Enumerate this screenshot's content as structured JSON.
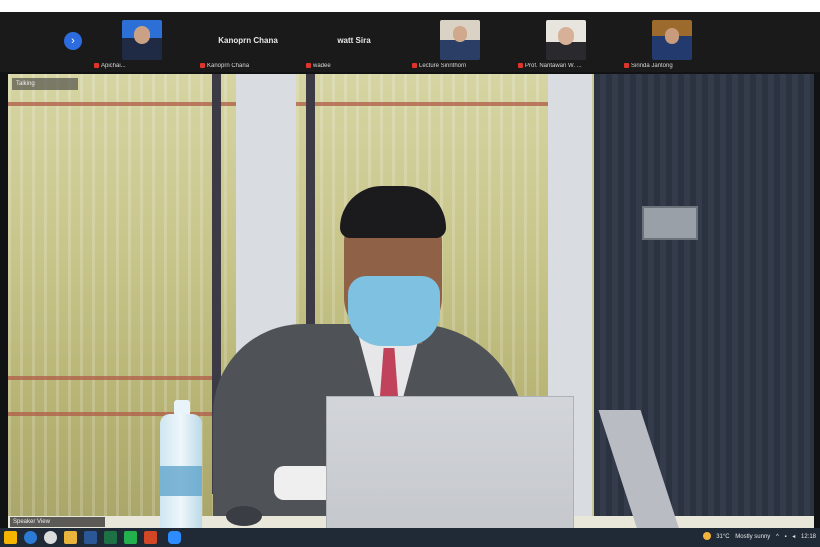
{
  "app": {
    "strip": {
      "nav_icon": "chevron-right-icon",
      "tiles": [
        {
          "type": "video",
          "label": "Apichai..."
        },
        {
          "type": "name",
          "display_name": "Kanoprn Chana",
          "label": "Kanoprn Chana"
        },
        {
          "type": "name",
          "display_name": "watt Sira",
          "label": "wadee"
        },
        {
          "type": "video",
          "label": "Lecture Sirinthorn"
        },
        {
          "type": "video",
          "label": "Prof. Nantawan W. ..."
        },
        {
          "type": "video",
          "label": "Sirinda Jantong"
        }
      ]
    },
    "main_video": {
      "corner_label": "Talking",
      "name_label": "Speaker View"
    }
  },
  "taskbar": {
    "icons": [
      "windows-start-icon",
      "search-icon",
      "chrome-icon",
      "folder-icon",
      "word-icon",
      "excel-icon",
      "powerpoint-icon",
      "line-icon",
      "zoom-icon"
    ],
    "tray": {
      "weather": "31°C",
      "condition": "Mostly sunny",
      "time": "12:18"
    }
  },
  "colors": {
    "mic_muted": "#e0342b",
    "taskbar": "#1f2a36",
    "accent": "#2d6cdf"
  }
}
